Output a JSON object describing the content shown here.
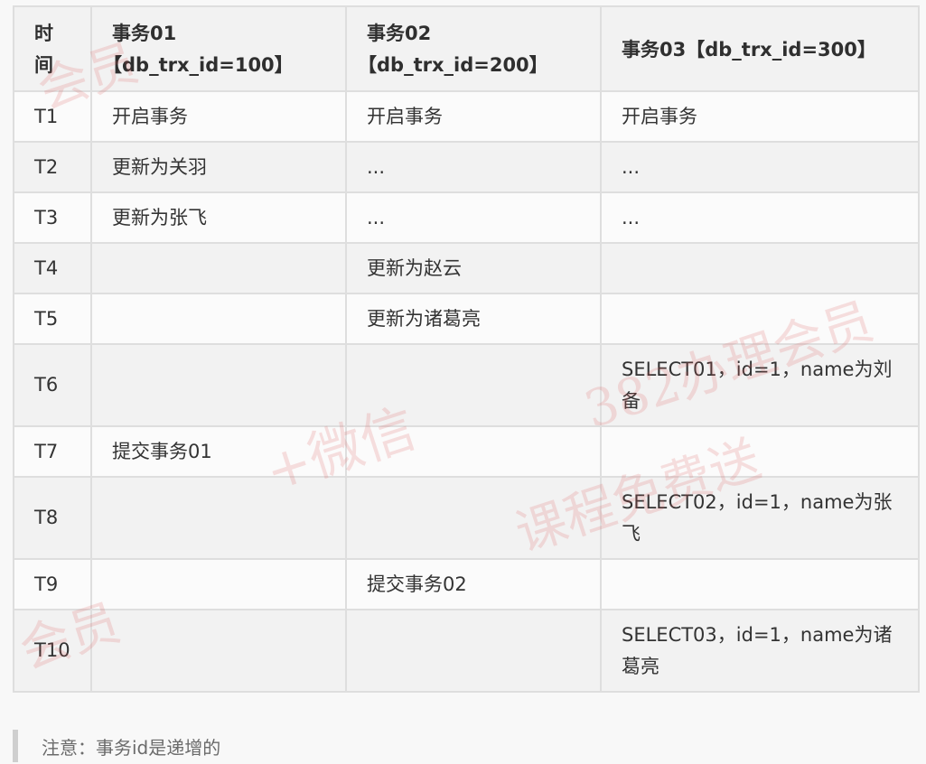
{
  "table": {
    "headers": [
      {
        "line1": "时",
        "line2": "间"
      },
      {
        "line1": "事务01",
        "line2": "【db_trx_id=100】"
      },
      {
        "line1": "事务02",
        "line2": "【db_trx_id=200】"
      },
      {
        "line1": "事务03【db_trx_id=300】",
        "line2": ""
      }
    ],
    "rows": [
      {
        "time": "T1",
        "tx1": "开启事务",
        "tx2": "开启事务",
        "tx3": "开启事务"
      },
      {
        "time": "T2",
        "tx1": "更新为关羽",
        "tx2": "...",
        "tx3": "..."
      },
      {
        "time": "T3",
        "tx1": "更新为张飞",
        "tx2": "...",
        "tx3": "..."
      },
      {
        "time": "T4",
        "tx1": "",
        "tx2": "更新为赵云",
        "tx3": ""
      },
      {
        "time": "T5",
        "tx1": "",
        "tx2": "更新为诸葛亮",
        "tx3": ""
      },
      {
        "time": "T6",
        "tx1": "",
        "tx2": "",
        "tx3": "SELECT01，id=1，name为刘备"
      },
      {
        "time": "T7",
        "tx1": "提交事务01",
        "tx2": "",
        "tx3": ""
      },
      {
        "time": "T8",
        "tx1": "",
        "tx2": "",
        "tx3": "SELECT02，id=1，name为张飞"
      },
      {
        "time": "T9",
        "tx1": "",
        "tx2": "提交事务02",
        "tx3": ""
      },
      {
        "time": "T10",
        "tx1": "",
        "tx2": "",
        "tx3": "SELECT03，id=1，name为诸葛亮"
      }
    ]
  },
  "note": {
    "text": "注意：事务id是递增的"
  },
  "watermarks": [
    "会员",
    "会员",
    "+微信",
    "382办理会员",
    "课程免费送"
  ]
}
